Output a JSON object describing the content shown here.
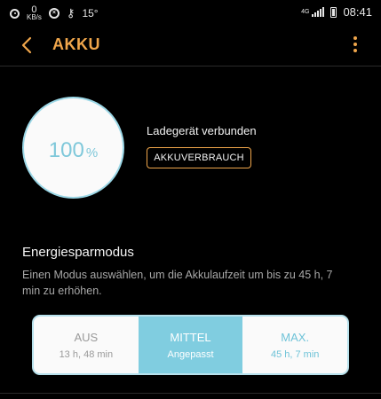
{
  "statusbar": {
    "netspeed_value": "0",
    "netspeed_unit": "KB/s",
    "temperature": "15°",
    "network_type": "4G",
    "time": "08:41"
  },
  "appbar": {
    "title": "AKKU"
  },
  "battery": {
    "level": "100",
    "unit": "%",
    "level_fraction": 1.0,
    "charger_status": "Ladegerät verbunden",
    "usage_button": "AKKUVERBRAUCH"
  },
  "power_saving": {
    "title": "Energiesparmodus",
    "description": "Einen Modus auswählen, um die Akkulaufzeit um bis zu 45 h, 7 min zu erhöhen.",
    "modes": [
      {
        "name": "AUS",
        "sub": "13 h, 48 min",
        "selected": false
      },
      {
        "name": "MITTEL",
        "sub": "Angepasst",
        "selected": true
      },
      {
        "name": "MAX.",
        "sub": "45 h, 7 min",
        "selected": false
      }
    ]
  },
  "colors": {
    "accent": "#f0a64b",
    "gauge": "#7fc8da",
    "selected_mode": "#80cde0"
  }
}
